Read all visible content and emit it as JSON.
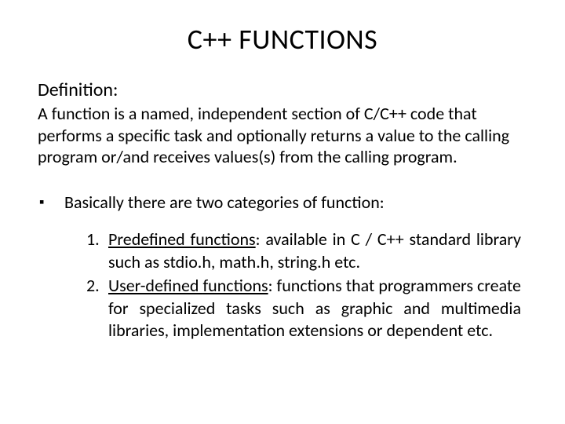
{
  "title": "C++ FUNCTIONS",
  "definition": {
    "heading": "Definition:",
    "body": "A function is a named, independent section of C/C++ code that performs a specific task and optionally returns a value to the calling program or/and receives values(s) from the calling program."
  },
  "bullet": {
    "marker": "▪",
    "text": "Basically there are two categories of function:"
  },
  "list": {
    "items": [
      {
        "marker": "1.",
        "label": "Predefined functions",
        "rest": ": available in C / C++ standard library such as stdio.h, math.h, string.h etc."
      },
      {
        "marker": "2.",
        "label": "User-defined ",
        "label2": "functions",
        "rest": ": functions that programmers create for specialized tasks such as graphic and multimedia libraries, implementation extensions or dependent etc."
      }
    ]
  }
}
